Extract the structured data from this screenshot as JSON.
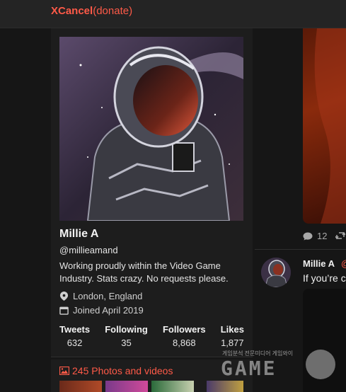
{
  "header": {
    "brand_bold": "XCancel",
    "brand_suffix": "(donate)"
  },
  "profile": {
    "display_name": "Millie A",
    "handle": "@millieamand",
    "bio": "Working proudly within the Video Game Industry. Stats crazy. No requests please.",
    "location": "London, England",
    "joined": "Joined April 2019",
    "avatar_icon": "astronaut-avatar",
    "stats": [
      {
        "label": "Tweets",
        "value": "632"
      },
      {
        "label": "Following",
        "value": "35"
      },
      {
        "label": "Followers",
        "value": "8,868"
      },
      {
        "label": "Likes",
        "value": "1,877"
      }
    ]
  },
  "media": {
    "label": "245 Photos and videos"
  },
  "timeline": {
    "reply_count": "12",
    "tweet_author": "Millie A",
    "tweet_handle_fragment": "@",
    "tweet_text_fragment": "If you’re c"
  },
  "watermark": {
    "small_text": "게임분석 전문미디어 게임와이",
    "big_text": "GAME"
  },
  "colors": {
    "accent": "#ff5a48",
    "background": "#161616",
    "card": "#1d1d1d"
  }
}
